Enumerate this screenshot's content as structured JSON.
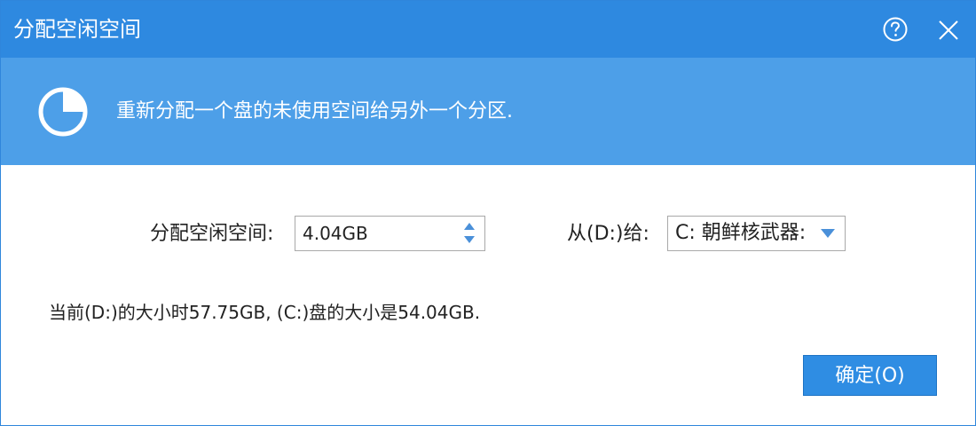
{
  "window": {
    "title": "分配空闲空间",
    "help_icon": "help-icon",
    "close_icon": "close-icon"
  },
  "banner": {
    "icon": "pie-chart-icon",
    "text": "重新分配一个盘的未使用空间给另外一个分区."
  },
  "form": {
    "allocate_label": "分配空闲空间:",
    "allocate_value": "4.04GB",
    "from_label": "从(D:)给:",
    "target_value": "C: 朝鲜核武器:"
  },
  "status": "当前(D:)的大小时57.75GB, (C:)盘的大小是54.04GB.",
  "buttons": {
    "ok_label": "确定(O)"
  },
  "colors": {
    "titlebar": "#2e89e0",
    "banner": "#4d9fe8",
    "button": "#2f8de3",
    "arrow": "#4a90d9"
  }
}
